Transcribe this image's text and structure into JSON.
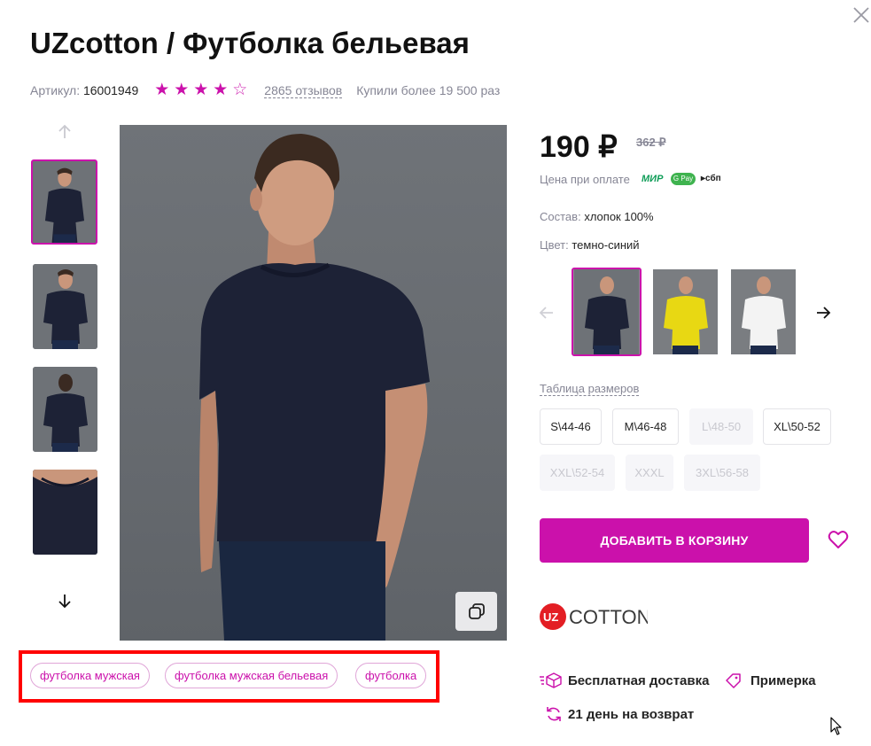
{
  "product": {
    "title": "UZcotton / Футболка бельевая",
    "article_label": "Артикул:",
    "article_value": "16001949",
    "rating": 4,
    "rating_max": 5,
    "reviews": "2865 отзывов",
    "bought": "Купили более 19 500 раз"
  },
  "price": {
    "current": "190 ₽",
    "old": "362 ₽",
    "payment_text": "Цена при оплате",
    "payment_methods": [
      "МИР",
      "G Pay",
      "сбп"
    ]
  },
  "details": {
    "composition_label": "Состав:",
    "composition_value": "хлопок 100%",
    "color_label": "Цвет:",
    "color_value": "темно-синий"
  },
  "colors": [
    {
      "name": "темно-синий",
      "shirt": "#1d2236"
    },
    {
      "name": "желтый",
      "shirt": "#e8d813"
    },
    {
      "name": "белый",
      "shirt": "#f3f3f3"
    }
  ],
  "size_table_label": "Таблица размеров",
  "sizes": [
    {
      "label": "S\\44-46",
      "available": true
    },
    {
      "label": "M\\46-48",
      "available": true
    },
    {
      "label": "L\\48-50",
      "available": false
    },
    {
      "label": "XL\\50-52",
      "available": true
    },
    {
      "label": "XXL\\52-54",
      "available": false
    },
    {
      "label": "XXXL",
      "available": false
    },
    {
      "label": "3XL\\56-58",
      "available": false
    }
  ],
  "add_to_cart": "ДОБАВИТЬ В КОРЗИНУ",
  "brand": {
    "logo_mark": "UZ",
    "logo_text": "COTTON"
  },
  "features": {
    "delivery": "Бесплатная доставка",
    "fitting": "Примерка",
    "return": "21 день на возврат"
  },
  "tags": [
    "футболка мужская",
    "футболка мужская бельевая",
    "футболка"
  ],
  "icons": {
    "close": "close-icon",
    "up": "arrow-up-icon",
    "down": "arrow-down-icon",
    "zoom": "copy-zoom-icon",
    "heart": "heart-icon",
    "prev": "arrow-left-icon",
    "next": "arrow-right-icon"
  },
  "colors_ui": {
    "accent": "#cb11ab",
    "muted": "#868695",
    "text": "#242424"
  }
}
